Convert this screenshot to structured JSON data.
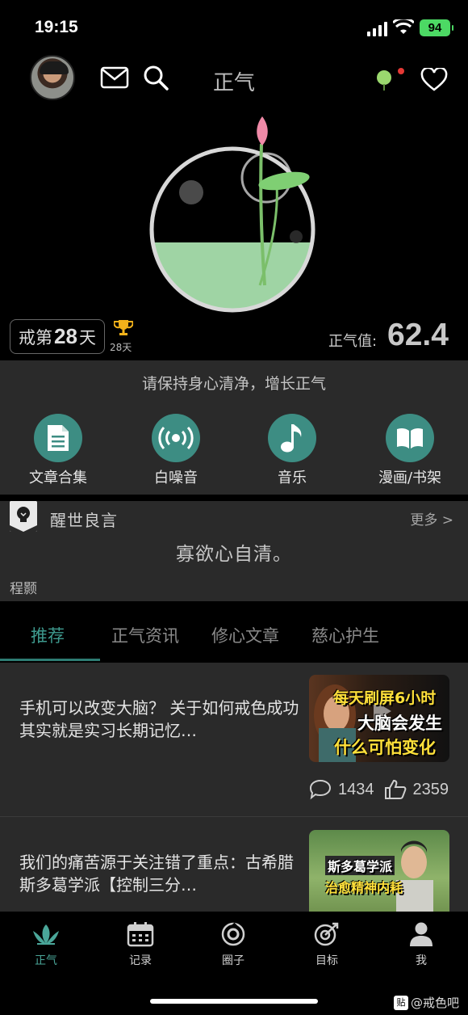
{
  "status_bar": {
    "time": "19:15",
    "battery": "94"
  },
  "header": {
    "title": "正气"
  },
  "hero": {
    "streak_prefix": "戒第",
    "streak_days": "28",
    "streak_suffix": "天",
    "best_streak": "28天",
    "qi_label": "正气值:",
    "qi_value": "62.4"
  },
  "motto": "请保持身心清净，增长正气",
  "actions": [
    {
      "label": "文章合集",
      "icon": "document-icon"
    },
    {
      "label": "白噪音",
      "icon": "broadcast-icon"
    },
    {
      "label": "音乐",
      "icon": "music-note-icon"
    },
    {
      "label": "漫画/书架",
      "icon": "book-icon"
    }
  ],
  "wise_words": {
    "title": "醒世良言",
    "more": "更多 >",
    "quote": "寡欲心自清。",
    "author": "程颢"
  },
  "tabs": [
    {
      "label": "推荐",
      "active": true
    },
    {
      "label": "正气资讯",
      "active": false
    },
    {
      "label": "修心文章",
      "active": false
    },
    {
      "label": "慈心护生",
      "active": false
    }
  ],
  "feed": [
    {
      "title": "手机可以改变大脑？  关于如何戒色成功其实就是实习长期记忆…",
      "thumb_lines": [
        "每天刷屏6小时",
        "大脑会发生",
        "什么可怕变化"
      ],
      "comments": "1434",
      "likes": "2359"
    },
    {
      "title": "我们的痛苦源于关注错了重点：古希腊斯多葛学派【控制三分…",
      "thumb_lines": [
        "斯多葛学派",
        "治愈精神内耗"
      ]
    }
  ],
  "bottom_nav": [
    {
      "label": "正气",
      "icon": "lotus-icon",
      "active": true
    },
    {
      "label": "记录",
      "icon": "calendar-icon",
      "active": false
    },
    {
      "label": "圈子",
      "icon": "circle-icon",
      "active": false
    },
    {
      "label": "目标",
      "icon": "target-icon",
      "active": false
    },
    {
      "label": "我",
      "icon": "user-icon",
      "active": false
    }
  ],
  "watermark": {
    "badge": "贴",
    "text": "@戒色吧"
  },
  "colors": {
    "accent": "#3d8d83",
    "tab_active": "#3e9a8e",
    "water": "#9fd4a4",
    "lotus": "#f08aa8"
  }
}
